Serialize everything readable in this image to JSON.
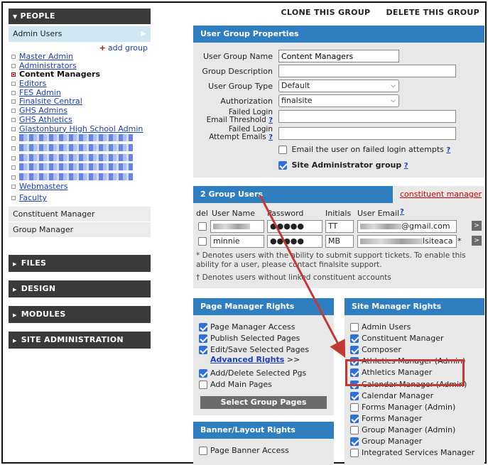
{
  "top_links": {
    "clone": "CLONE THIS GROUP",
    "delete": "DELETE THIS GROUP"
  },
  "sidebar": {
    "people_header": "PEOPLE",
    "selected_item": "Admin Users",
    "add_group": "add group",
    "groups": [
      {
        "label": "Master Admin",
        "current": false
      },
      {
        "label": "Administrators",
        "current": false
      },
      {
        "label": "Content Managers",
        "current": true
      },
      {
        "label": "Editors",
        "current": false
      },
      {
        "label": "FES Admin",
        "current": false
      },
      {
        "label": "Finalsite Central",
        "current": false
      },
      {
        "label": "GHS Admins",
        "current": false
      },
      {
        "label": "GHS Athletics",
        "current": false
      },
      {
        "label": "Glastonbury High School Admin",
        "current": false
      }
    ],
    "groups_after_blur": [
      {
        "label": "Webmasters"
      },
      {
        "label": "Faculty"
      }
    ],
    "items": [
      "Constituent Manager",
      "Group Manager"
    ],
    "sections": [
      "FILES",
      "DESIGN",
      "MODULES",
      "SITE ADMINISTRATION"
    ]
  },
  "properties": {
    "header": "User Group Properties",
    "name_label": "User Group Name",
    "name_value": "Content Managers",
    "desc_label": "Group Description",
    "desc_value": "",
    "type_label": "User Group Type",
    "type_value": "Default",
    "auth_label": "Authorization",
    "auth_value": "finalsite",
    "failed_threshold_label_1": "Failed Login",
    "failed_threshold_label_2": "Email Threshold",
    "failed_emails_label_1": "Failed Login",
    "failed_emails_label_2": "Attempt Emails",
    "help": "?",
    "email_failed_label": "Email the user on failed login attempts",
    "site_admin_label": "Site Administrator group"
  },
  "users": {
    "header": "2 Group Users",
    "cm_link": "constituent manager",
    "help": "?",
    "cols": {
      "del": "del",
      "user": "User Name",
      "password": "Password",
      "initials": "Initials",
      "email": "User Email"
    },
    "rows": [
      {
        "initials": "TT",
        "email_suffix": "@gmail.com",
        "username": "",
        "mark": ""
      },
      {
        "initials": "MB",
        "email_suffix": "lsiteaca",
        "username": "minnie",
        "mark": "*"
      }
    ],
    "go": ">",
    "note1": "* Denotes users with the ability to submit support tickets. To enable this ability for a user, please contact finalsite support.",
    "note2": "† Denotes users without linked constituent accounts"
  },
  "page_rights": {
    "header": "Page Manager Rights",
    "items": [
      {
        "label": "Page Manager Access",
        "checked": true
      },
      {
        "label": "Publish Selected Pages",
        "checked": true
      },
      {
        "label": "Edit/Save Selected Pages",
        "checked": true
      },
      {
        "label": "Add/Delete Selected Pgs",
        "checked": true
      },
      {
        "label": "Add Main Pages",
        "checked": false
      }
    ],
    "advanced": "Advanced Rights",
    "advanced_suffix": ">>",
    "select_btn": "Select Group Pages"
  },
  "site_rights": {
    "header": "Site Manager Rights",
    "items": [
      {
        "label": "Admin Users",
        "checked": false
      },
      {
        "label": "Constituent Manager",
        "checked": true
      },
      {
        "label": "Composer",
        "checked": true
      },
      {
        "label": "Athletics Manager (Admin)",
        "checked": true
      },
      {
        "label": "Athletics Manager",
        "checked": true
      },
      {
        "label": "Calendar Manager (Admin)",
        "checked": true
      },
      {
        "label": "Calendar Manager",
        "checked": true
      },
      {
        "label": "Forms Manager (Admin)",
        "checked": false
      },
      {
        "label": "Forms Manager",
        "checked": true
      },
      {
        "label": "Group Manager (Admin)",
        "checked": false
      },
      {
        "label": "Group Manager",
        "checked": true
      },
      {
        "label": "Integrated Services Manager",
        "checked": false
      }
    ]
  },
  "banner_rights": {
    "header": "Banner/Layout Rights",
    "items": [
      {
        "label": "Page Banner Access",
        "checked": false
      }
    ]
  },
  "colors": {
    "accent": "#2f7fc0",
    "highlight": "#c23a36",
    "sidebar_dark": "#3a3a3a",
    "link": "#1a3fbf"
  }
}
